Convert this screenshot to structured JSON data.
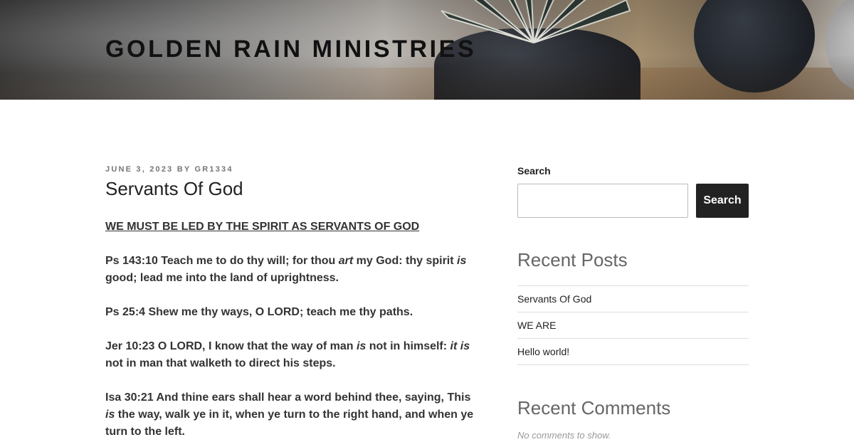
{
  "header": {
    "site_title": "GOLDEN RAIN MINISTRIES"
  },
  "post": {
    "meta": "JUNE 3, 2023 BY GR1334",
    "title": "Servants Of God",
    "heading": "WE MUST BE LED BY THE SPIRIT AS SERVANTS OF GOD",
    "verses": [
      {
        "a": "Ps 143:10 Teach me to do thy will; for thou ",
        "b": "art",
        "c": " my God: thy spirit ",
        "d": "is",
        "e": " good; lead me into the land of uprightness."
      },
      {
        "a": "Ps 25:4 Shew me thy ways, O LORD; teach me thy paths."
      },
      {
        "a": "Jer 10:23 O LORD, I know that the way of man ",
        "b": "is",
        "c": " not in himself: ",
        "d": "it is",
        "e": " not in man that walketh to direct his steps."
      },
      {
        "a": "Isa 30:21 And thine ears shall hear a word behind thee, saying, This ",
        "b": "is",
        "c": " the way, walk ye in it, when ye turn to the right hand, and when ye turn to the left."
      }
    ]
  },
  "sidebar": {
    "search_label": "Search",
    "search_value": "",
    "search_button": "Search",
    "recent_posts_title": "Recent Posts",
    "recent_posts": [
      "Servants Of God",
      "WE ARE",
      "Hello world!"
    ],
    "recent_comments_title": "Recent Comments",
    "no_comments": "No comments to show."
  }
}
